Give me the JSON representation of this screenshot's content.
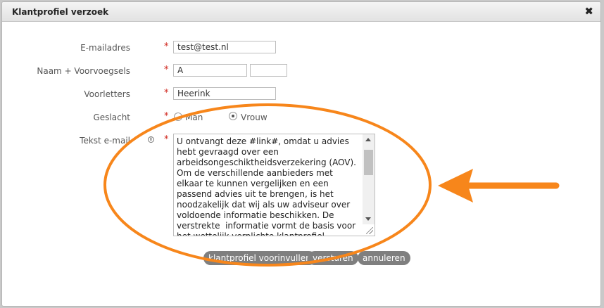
{
  "dialog": {
    "title": "Klantprofiel verzoek",
    "close_symbol": "✖"
  },
  "form": {
    "email": {
      "label": "E-mailadres",
      "value": "test@test.nl"
    },
    "name": {
      "label": "Naam + Voorvoegsels",
      "value": "A",
      "prefix_value": ""
    },
    "initials": {
      "label": "Voorletters",
      "value": "Heerink"
    },
    "gender": {
      "label": "Geslacht",
      "options": [
        {
          "label": "Man",
          "selected": false
        },
        {
          "label": "Vrouw",
          "selected": true
        }
      ]
    },
    "email_text": {
      "label": "Tekst e-mail",
      "info_symbol": "i",
      "value": "U ontvangt deze #link#, omdat u advies hebt gevraagd over een arbeidsongeschiktheidsverzekering (AOV). Om de verschillende aanbieders met elkaar te kunnen vergelijken en een passend advies uit te brengen, is het noodzakelijk dat wij als uw adviseur over voldoende informatie beschikken. De verstrekte  informatie vormt de basis voor het wettelijk verplichte klantprofiel."
    },
    "required_marker": "*"
  },
  "buttons": {
    "prefill": "klantprofiel voorinvullen",
    "send": "versturen",
    "cancel": "annuleren"
  },
  "annotation": {
    "color": "#f7861b"
  }
}
